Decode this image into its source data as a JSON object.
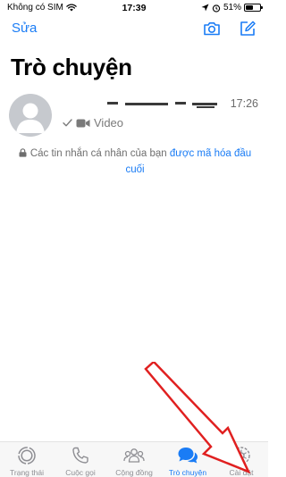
{
  "status_bar": {
    "carrier": "Không có SIM",
    "time": "17:39",
    "battery": "51%",
    "battery_level": 0.51
  },
  "nav": {
    "edit_label": "Sửa",
    "camera_icon": "camera-icon",
    "compose_icon": "compose-icon"
  },
  "page_title": "Trò chuyện",
  "chats": [
    {
      "time": "17:26",
      "preview": "Video"
    }
  ],
  "encryption": {
    "text": "Các tin nhắn cá nhân của bạn ",
    "link": "được mã hóa đầu cuối"
  },
  "tabs": [
    {
      "label": "Trạng thái",
      "icon": "status-icon",
      "active": false
    },
    {
      "label": "Cuộc gọi",
      "icon": "phone-icon",
      "active": false
    },
    {
      "label": "Cộng đồng",
      "icon": "community-icon",
      "active": false
    },
    {
      "label": "Trò chuyện",
      "icon": "chats-icon",
      "active": true
    },
    {
      "label": "Cài đặt",
      "icon": "settings-icon",
      "active": false
    }
  ],
  "colors": {
    "accent": "#1a7cf5",
    "annotation": "#e02020",
    "inactive": "#8e8e93"
  }
}
